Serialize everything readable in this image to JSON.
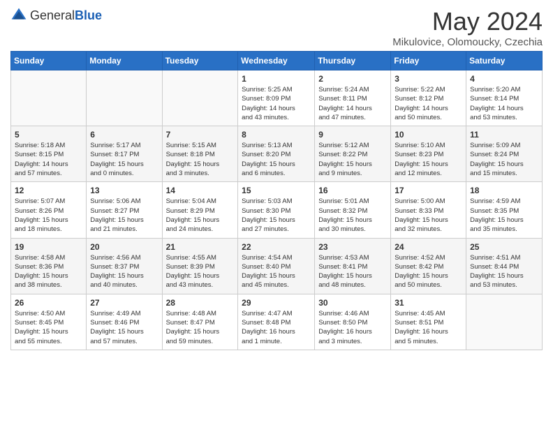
{
  "logo": {
    "general": "General",
    "blue": "Blue"
  },
  "title": "May 2024",
  "location": "Mikulovice, Olomoucky, Czechia",
  "weekdays": [
    "Sunday",
    "Monday",
    "Tuesday",
    "Wednesday",
    "Thursday",
    "Friday",
    "Saturday"
  ],
  "weeks": [
    [
      {
        "day": "",
        "info": ""
      },
      {
        "day": "",
        "info": ""
      },
      {
        "day": "",
        "info": ""
      },
      {
        "day": "1",
        "info": "Sunrise: 5:25 AM\nSunset: 8:09 PM\nDaylight: 14 hours\nand 43 minutes."
      },
      {
        "day": "2",
        "info": "Sunrise: 5:24 AM\nSunset: 8:11 PM\nDaylight: 14 hours\nand 47 minutes."
      },
      {
        "day": "3",
        "info": "Sunrise: 5:22 AM\nSunset: 8:12 PM\nDaylight: 14 hours\nand 50 minutes."
      },
      {
        "day": "4",
        "info": "Sunrise: 5:20 AM\nSunset: 8:14 PM\nDaylight: 14 hours\nand 53 minutes."
      }
    ],
    [
      {
        "day": "5",
        "info": "Sunrise: 5:18 AM\nSunset: 8:15 PM\nDaylight: 14 hours\nand 57 minutes."
      },
      {
        "day": "6",
        "info": "Sunrise: 5:17 AM\nSunset: 8:17 PM\nDaylight: 15 hours\nand 0 minutes."
      },
      {
        "day": "7",
        "info": "Sunrise: 5:15 AM\nSunset: 8:18 PM\nDaylight: 15 hours\nand 3 minutes."
      },
      {
        "day": "8",
        "info": "Sunrise: 5:13 AM\nSunset: 8:20 PM\nDaylight: 15 hours\nand 6 minutes."
      },
      {
        "day": "9",
        "info": "Sunrise: 5:12 AM\nSunset: 8:22 PM\nDaylight: 15 hours\nand 9 minutes."
      },
      {
        "day": "10",
        "info": "Sunrise: 5:10 AM\nSunset: 8:23 PM\nDaylight: 15 hours\nand 12 minutes."
      },
      {
        "day": "11",
        "info": "Sunrise: 5:09 AM\nSunset: 8:24 PM\nDaylight: 15 hours\nand 15 minutes."
      }
    ],
    [
      {
        "day": "12",
        "info": "Sunrise: 5:07 AM\nSunset: 8:26 PM\nDaylight: 15 hours\nand 18 minutes."
      },
      {
        "day": "13",
        "info": "Sunrise: 5:06 AM\nSunset: 8:27 PM\nDaylight: 15 hours\nand 21 minutes."
      },
      {
        "day": "14",
        "info": "Sunrise: 5:04 AM\nSunset: 8:29 PM\nDaylight: 15 hours\nand 24 minutes."
      },
      {
        "day": "15",
        "info": "Sunrise: 5:03 AM\nSunset: 8:30 PM\nDaylight: 15 hours\nand 27 minutes."
      },
      {
        "day": "16",
        "info": "Sunrise: 5:01 AM\nSunset: 8:32 PM\nDaylight: 15 hours\nand 30 minutes."
      },
      {
        "day": "17",
        "info": "Sunrise: 5:00 AM\nSunset: 8:33 PM\nDaylight: 15 hours\nand 32 minutes."
      },
      {
        "day": "18",
        "info": "Sunrise: 4:59 AM\nSunset: 8:35 PM\nDaylight: 15 hours\nand 35 minutes."
      }
    ],
    [
      {
        "day": "19",
        "info": "Sunrise: 4:58 AM\nSunset: 8:36 PM\nDaylight: 15 hours\nand 38 minutes."
      },
      {
        "day": "20",
        "info": "Sunrise: 4:56 AM\nSunset: 8:37 PM\nDaylight: 15 hours\nand 40 minutes."
      },
      {
        "day": "21",
        "info": "Sunrise: 4:55 AM\nSunset: 8:39 PM\nDaylight: 15 hours\nand 43 minutes."
      },
      {
        "day": "22",
        "info": "Sunrise: 4:54 AM\nSunset: 8:40 PM\nDaylight: 15 hours\nand 45 minutes."
      },
      {
        "day": "23",
        "info": "Sunrise: 4:53 AM\nSunset: 8:41 PM\nDaylight: 15 hours\nand 48 minutes."
      },
      {
        "day": "24",
        "info": "Sunrise: 4:52 AM\nSunset: 8:42 PM\nDaylight: 15 hours\nand 50 minutes."
      },
      {
        "day": "25",
        "info": "Sunrise: 4:51 AM\nSunset: 8:44 PM\nDaylight: 15 hours\nand 53 minutes."
      }
    ],
    [
      {
        "day": "26",
        "info": "Sunrise: 4:50 AM\nSunset: 8:45 PM\nDaylight: 15 hours\nand 55 minutes."
      },
      {
        "day": "27",
        "info": "Sunrise: 4:49 AM\nSunset: 8:46 PM\nDaylight: 15 hours\nand 57 minutes."
      },
      {
        "day": "28",
        "info": "Sunrise: 4:48 AM\nSunset: 8:47 PM\nDaylight: 15 hours\nand 59 minutes."
      },
      {
        "day": "29",
        "info": "Sunrise: 4:47 AM\nSunset: 8:48 PM\nDaylight: 16 hours\nand 1 minute."
      },
      {
        "day": "30",
        "info": "Sunrise: 4:46 AM\nSunset: 8:50 PM\nDaylight: 16 hours\nand 3 minutes."
      },
      {
        "day": "31",
        "info": "Sunrise: 4:45 AM\nSunset: 8:51 PM\nDaylight: 16 hours\nand 5 minutes."
      },
      {
        "day": "",
        "info": ""
      }
    ]
  ]
}
